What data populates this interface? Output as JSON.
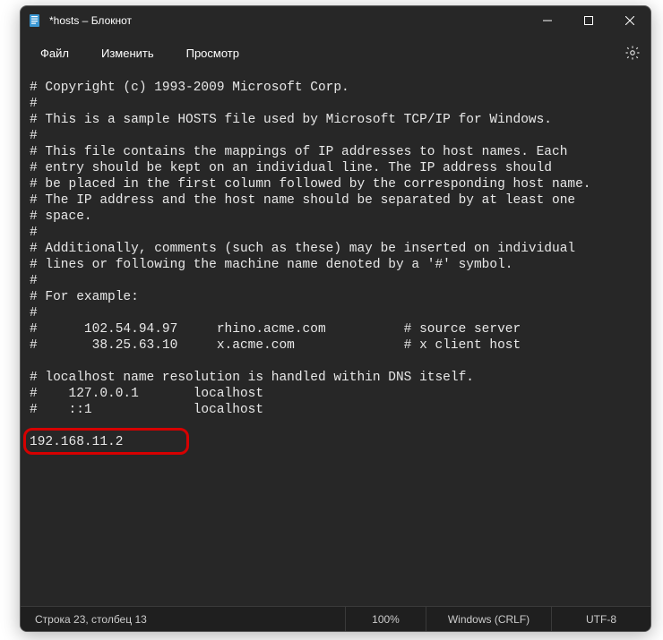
{
  "window": {
    "title": "*hosts – Блокнот"
  },
  "menu": {
    "file": "Файл",
    "edit": "Изменить",
    "view": "Просмотр"
  },
  "editor": {
    "content": "# Copyright (c) 1993-2009 Microsoft Corp.\n#\n# This is a sample HOSTS file used by Microsoft TCP/IP for Windows.\n#\n# This file contains the mappings of IP addresses to host names. Each\n# entry should be kept on an individual line. The IP address should\n# be placed in the first column followed by the corresponding host name.\n# The IP address and the host name should be separated by at least one\n# space.\n#\n# Additionally, comments (such as these) may be inserted on individual\n# lines or following the machine name denoted by a '#' symbol.\n#\n# For example:\n#\n#      102.54.94.97     rhino.acme.com          # source server\n#       38.25.63.10     x.acme.com              # x client host\n\n# localhost name resolution is handled within DNS itself.\n#    127.0.0.1       localhost\n#    ::1             localhost\n\n192.168.11.2",
    "highlight_value": "192.168.11.2"
  },
  "status": {
    "position": "Строка 23, столбец 13",
    "zoom": "100%",
    "line_ending": "Windows (CRLF)",
    "encoding": "UTF-8"
  },
  "icons": {
    "app": "notepad-icon",
    "minimize": "minimize-icon",
    "maximize": "maximize-icon",
    "close": "close-icon",
    "settings": "gear-icon"
  }
}
